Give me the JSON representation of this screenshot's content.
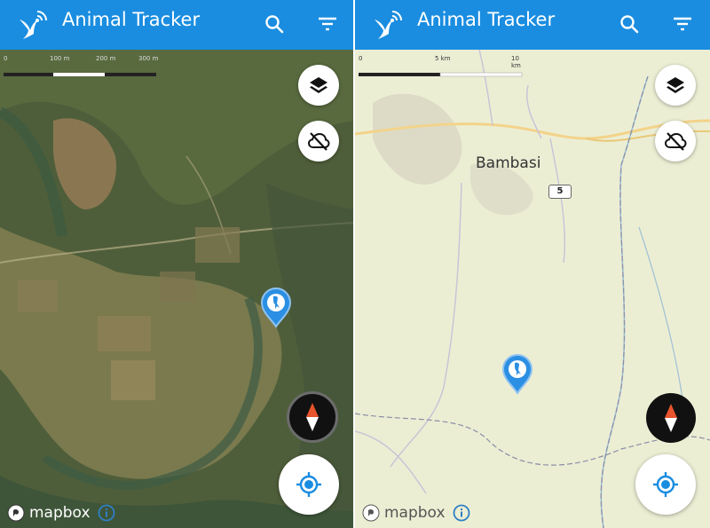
{
  "app": {
    "title": "Animal Tracker",
    "accent_color": "#1a8de0"
  },
  "left_pane": {
    "map_style": "satellite",
    "scale_labels": [
      "0",
      "100 m",
      "200 m",
      "300 m"
    ],
    "attribution": "mapbox",
    "icons": {
      "search": "search-icon",
      "filter": "filter-icon",
      "layers": "layers-icon",
      "offline": "cloud-off-icon",
      "compass": "compass-icon",
      "locate": "my-location-icon",
      "marker": "bird-marker-icon"
    }
  },
  "right_pane": {
    "map_style": "streets",
    "scale_labels": [
      "0",
      "5 km",
      "10 km"
    ],
    "place_label": "Bambasi",
    "road_number": "5",
    "attribution": "mapbox"
  }
}
